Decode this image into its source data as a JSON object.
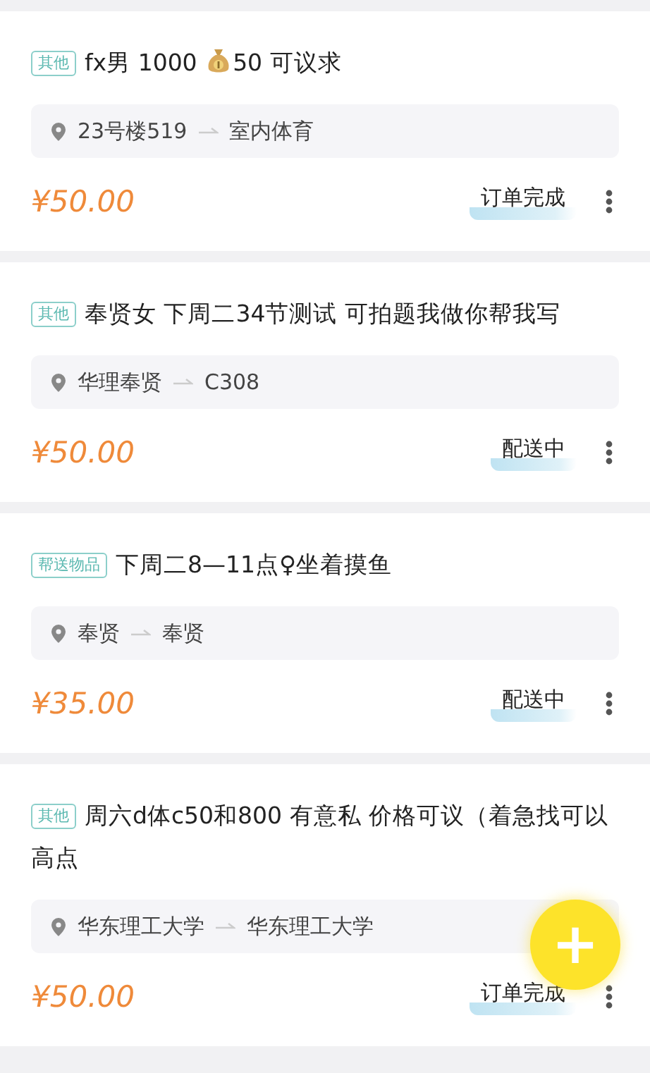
{
  "orders": [
    {
      "tag": "其他",
      "title": [
        {
          "kind": "text",
          "text": "fx男 1000 "
        },
        {
          "kind": "money-bag"
        },
        {
          "kind": "text",
          "text": "50 可议求"
        }
      ],
      "from": "23号楼519",
      "to": "室内体育",
      "price": "¥50.00",
      "status": "订单完成"
    },
    {
      "tag": "其他",
      "title": [
        {
          "kind": "text",
          "text": "奉贤女 下周二34节测试 可拍题我做你帮我写"
        }
      ],
      "from": "华理奉贤",
      "to": "C308",
      "price": "¥50.00",
      "status": "配送中"
    },
    {
      "tag": "帮送物品",
      "title": [
        {
          "kind": "text",
          "text": "下周二8—11点♀坐着摸鱼"
        }
      ],
      "from": "奉贤",
      "to": "奉贤",
      "price": "¥35.00",
      "status": "配送中"
    },
    {
      "tag": "其他",
      "title": [
        {
          "kind": "text",
          "text": "周六d体c50和800 有意私 价格可议（着急找可以高点"
        }
      ],
      "from": "华东理工大学",
      "to": "华东理工大学",
      "price": "¥50.00",
      "status": "订单完成"
    }
  ],
  "fab": {
    "label": "+"
  }
}
